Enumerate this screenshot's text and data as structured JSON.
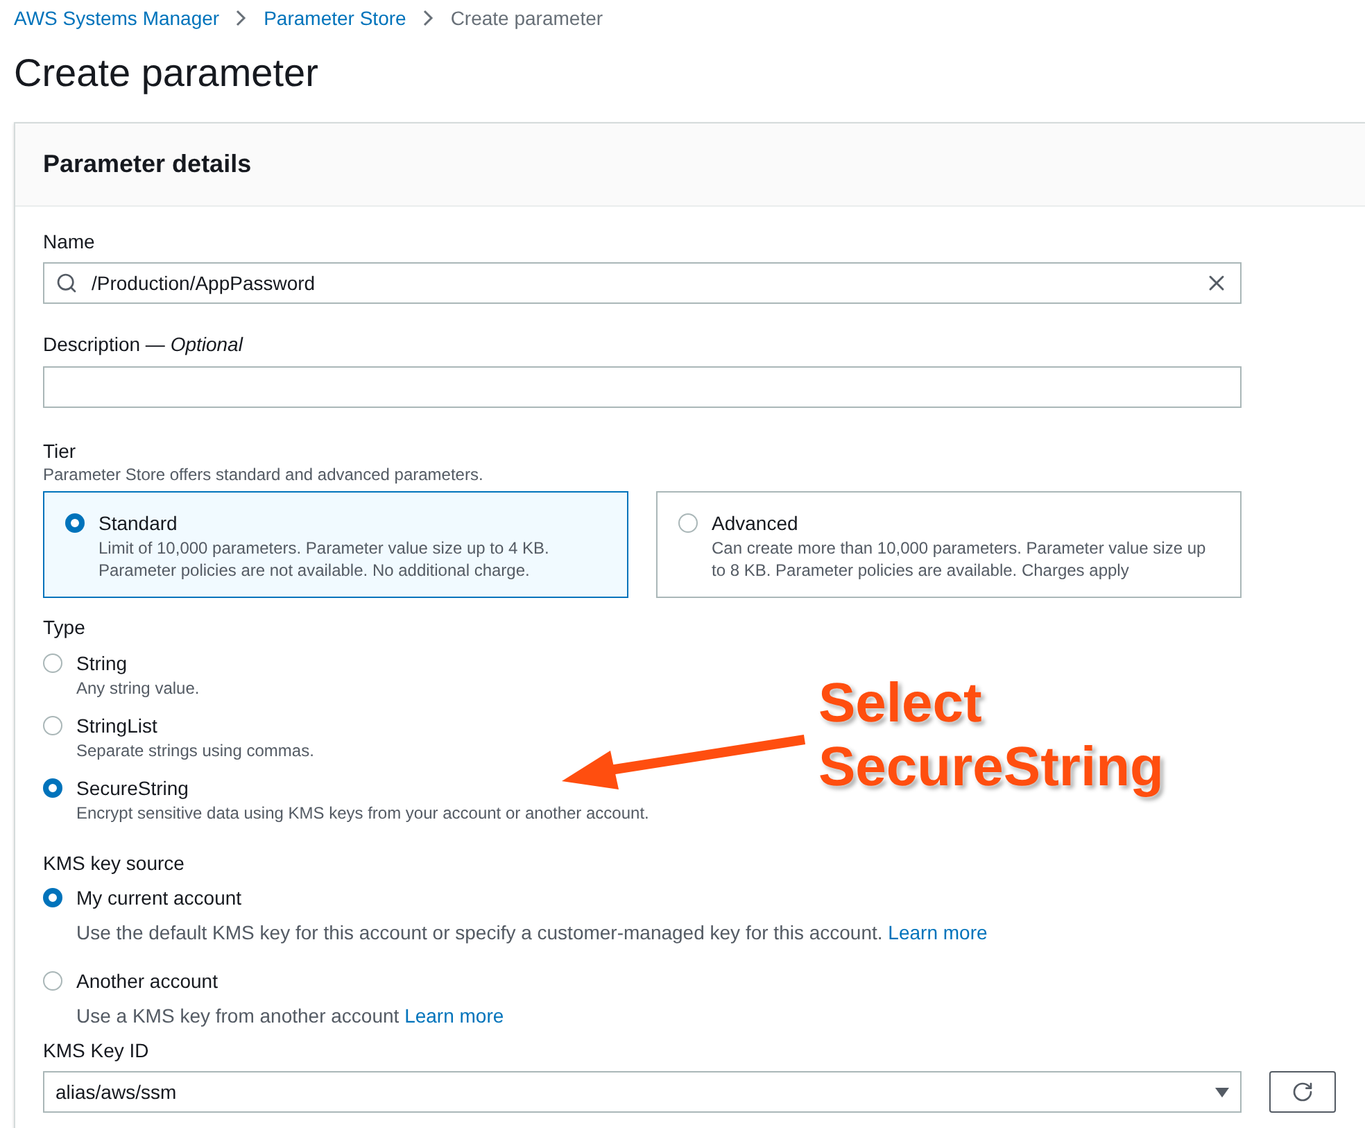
{
  "breadcrumbs": [
    {
      "label": "AWS Systems Manager",
      "kind": "link"
    },
    {
      "label": "Parameter Store",
      "kind": "link"
    },
    {
      "label": "Create parameter",
      "kind": "current"
    }
  ],
  "title": "Create parameter",
  "panel": {
    "title": "Parameter details",
    "name": {
      "label": "Name",
      "value": "/Production/AppPassword"
    },
    "description": {
      "label": "Description — ",
      "optional": "Optional"
    },
    "tier": {
      "label": "Tier",
      "hint": "Parameter Store offers standard and advanced parameters.",
      "options": [
        {
          "title": "Standard",
          "description": "Limit of 10,000 parameters. Parameter value size up to 4 KB. Parameter policies are not available. No additional charge.",
          "selected": true
        },
        {
          "title": "Advanced",
          "description": "Can create more than 10,000 parameters. Parameter value size up to 8 KB. Parameter policies are available. Charges apply",
          "selected": false
        }
      ]
    },
    "type": {
      "label": "Type",
      "options": [
        {
          "title": "String",
          "description": "Any string value.",
          "selected": false
        },
        {
          "title": "StringList",
          "description": "Separate strings using commas.",
          "selected": false
        },
        {
          "title": "SecureString",
          "description": "Encrypt sensitive data using KMS keys from your account or another account.",
          "selected": true
        }
      ]
    },
    "kms_key_source": {
      "label": "KMS key source",
      "options": [
        {
          "title": "My current account",
          "description": "Use the default KMS key for this account or specify a customer-managed key for this account.",
          "link": "Learn more",
          "selected": true
        },
        {
          "title": "Another account",
          "description": "Use a KMS key from another account",
          "link": "Learn more",
          "selected": false
        }
      ]
    },
    "kms_key_id": {
      "label": "KMS Key ID",
      "value": "alias/aws/ssm"
    }
  },
  "annotation": {
    "lines": [
      "Select",
      "SecureString"
    ]
  }
}
